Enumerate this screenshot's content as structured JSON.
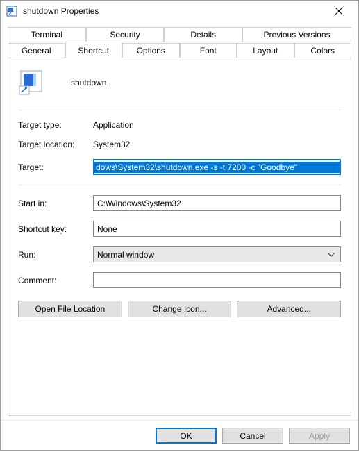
{
  "window": {
    "title": "shutdown Properties"
  },
  "tabs": {
    "row1": [
      "Terminal",
      "Security",
      "Details",
      "Previous Versions"
    ],
    "row2": [
      "General",
      "Shortcut",
      "Options",
      "Font",
      "Layout",
      "Colors"
    ],
    "active": "Shortcut"
  },
  "panel": {
    "name": "shutdown",
    "target_type_label": "Target type:",
    "target_type_value": "Application",
    "target_location_label": "Target location:",
    "target_location_value": "System32",
    "target_label": "Target:",
    "target_value": "dows\\System32\\shutdown.exe -s -t 7200 -c \"Goodbye\"",
    "start_in_label": "Start in:",
    "start_in_value": "C:\\Windows\\System32",
    "shortcut_key_label": "Shortcut key:",
    "shortcut_key_value": "None",
    "run_label": "Run:",
    "run_value": "Normal window",
    "comment_label": "Comment:",
    "comment_value": "",
    "open_file_location": "Open File Location",
    "change_icon": "Change Icon...",
    "advanced": "Advanced..."
  },
  "dialog": {
    "ok": "OK",
    "cancel": "Cancel",
    "apply": "Apply"
  }
}
